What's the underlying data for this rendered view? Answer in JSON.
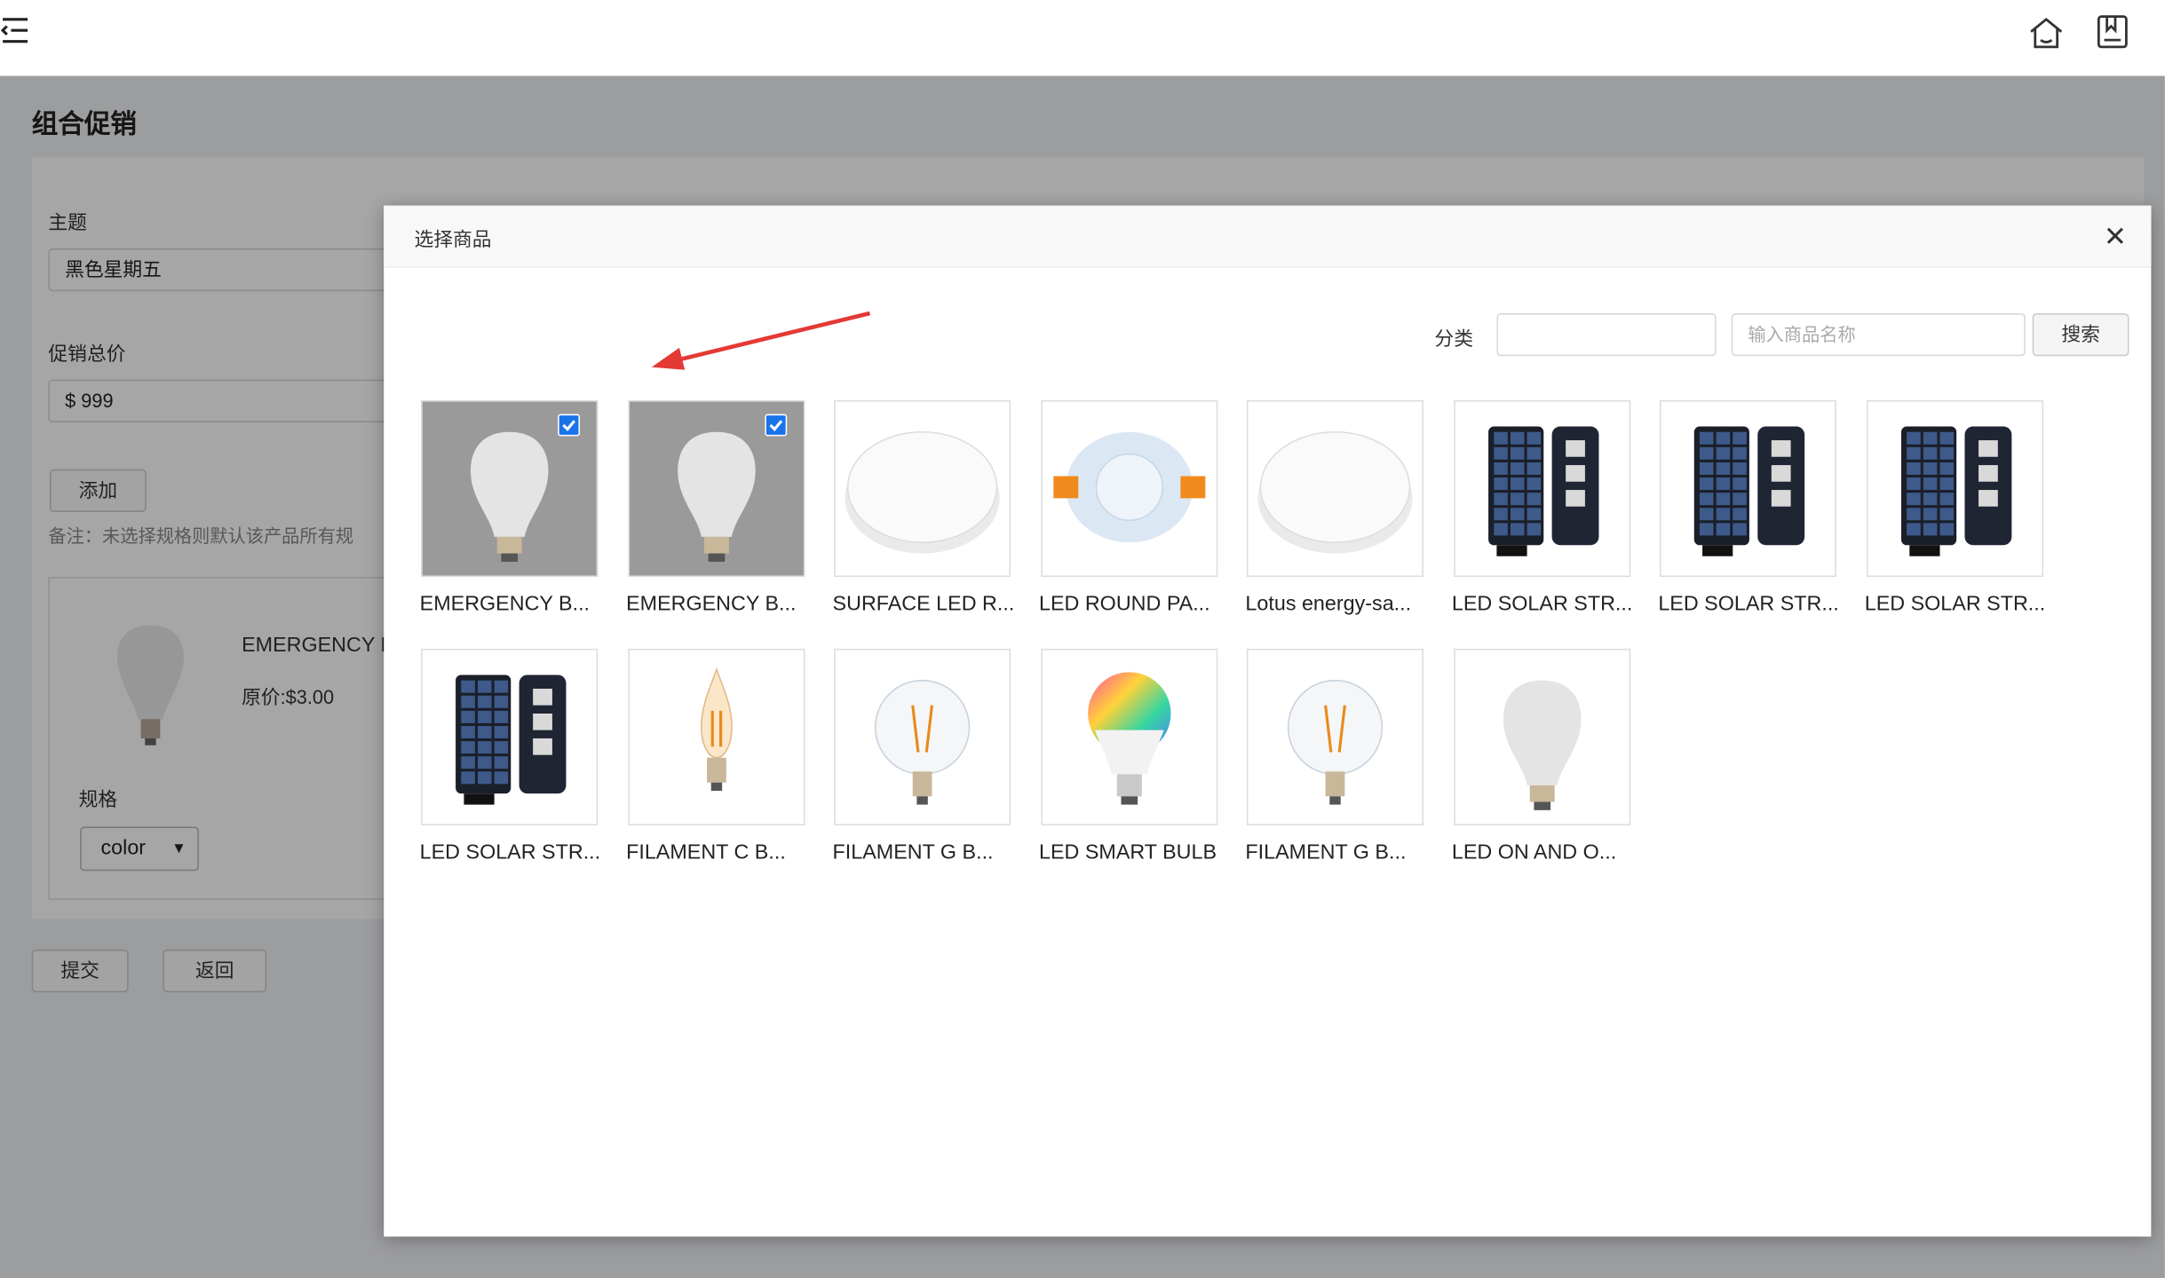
{
  "page": {
    "title": "组合促销",
    "form": {
      "subject_label": "主题",
      "subject_value": "黑色星期五",
      "total_label": "促销总价",
      "total_value": "$ 999",
      "add_button": "添加",
      "note": "备注：未选择规格则默认该产品所有规",
      "product": {
        "name": "EMERGENCY B",
        "price": "原价:$3.00",
        "spec_label": "规格",
        "spec_value": "color"
      },
      "submit_button": "提交",
      "back_button": "返回"
    }
  },
  "modal": {
    "title": "选择商品",
    "close_glyph": "✕",
    "category_label": "分类",
    "category_value": "",
    "name_placeholder": "输入商品名称",
    "search_button": "搜索",
    "items": [
      {
        "caption": "EMERGENCY B...",
        "icon": "bulb-icon",
        "checked": true
      },
      {
        "caption": "EMERGENCY B...",
        "icon": "bulb-icon",
        "checked": true
      },
      {
        "caption": "SURFACE LED R...",
        "icon": "round-panel-icon",
        "checked": false
      },
      {
        "caption": "LED ROUND PA...",
        "icon": "downlight-icon",
        "checked": false
      },
      {
        "caption": "Lotus energy-sa...",
        "icon": "round-panel-icon",
        "checked": false
      },
      {
        "caption": "LED SOLAR STR...",
        "icon": "solar-light-icon",
        "checked": false
      },
      {
        "caption": "LED SOLAR STR...",
        "icon": "solar-light-icon",
        "checked": false
      },
      {
        "caption": "LED SOLAR STR...",
        "icon": "solar-light-icon",
        "checked": false
      },
      {
        "caption": "LED SOLAR STR...",
        "icon": "solar-light-icon",
        "checked": false
      },
      {
        "caption": "FILAMENT C B...",
        "icon": "candle-bulb-icon",
        "checked": false
      },
      {
        "caption": "FILAMENT G B...",
        "icon": "globe-bulb-icon",
        "checked": false
      },
      {
        "caption": "LED SMART BULB",
        "icon": "smart-bulb-icon",
        "checked": false
      },
      {
        "caption": "FILAMENT G B...",
        "icon": "globe-bulb-icon",
        "checked": false
      },
      {
        "caption": "LED ON AND O...",
        "icon": "bulb-icon",
        "checked": false
      }
    ]
  },
  "colors": {
    "accent": "#1a73e8",
    "arrow": "#e53935",
    "overlay": "rgba(0,0,0,0.35)"
  }
}
